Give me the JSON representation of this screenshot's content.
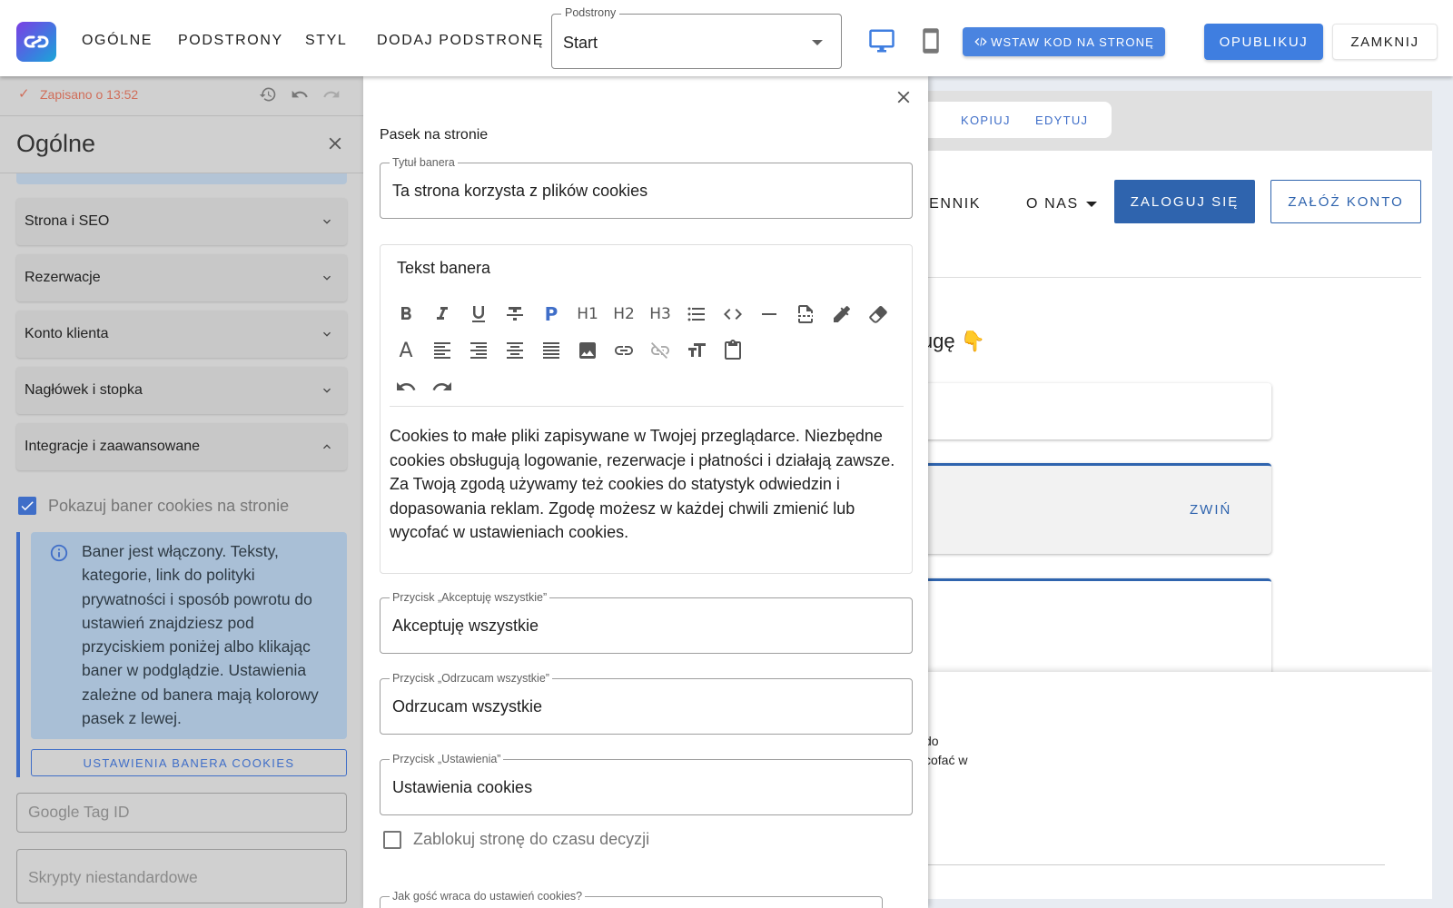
{
  "topbar": {
    "nav": [
      "OGÓLNE",
      "PODSTRONY",
      "STYL",
      "DODAJ PODSTRONĘ"
    ],
    "subpages_legend": "Podstrony",
    "subpages_value": "Start",
    "insert_code_label": "WSTAW KOD NA STRONĘ",
    "publish_label": "OPUBLIKUJ",
    "close_label": "ZAMKNIJ"
  },
  "left": {
    "saved_text": "Zapisano o 13:52",
    "title": "Ogólne",
    "accordion": [
      {
        "label": "Strona i SEO"
      },
      {
        "label": "Rezerwacje"
      },
      {
        "label": "Konto klienta"
      },
      {
        "label": "Nagłówek i stopka"
      },
      {
        "label": "Integracje i zaawansowane"
      }
    ],
    "cookie_checkbox_label": "Pokazuj baner cookies na stronie",
    "info_text": "Baner jest włączony. Teksty, kategorie, link do polityki prywatności i sposób powrotu do ustawień znajdziesz pod przyciskiem poniżej albo klikając baner w podglądzie. Ustawienia zależne od banera mają kolorowy pasek z lewej.",
    "cookie_settings_button": "USTAWIENIA BANERA COOKIES",
    "google_tag_placeholder": "Google Tag ID",
    "custom_scripts_placeholder": "Skrypty niestandardowe"
  },
  "editor": {
    "section_title": "Pasek na stronie",
    "banner_title_legend": "Tytuł banera",
    "banner_title_value": "Ta strona korzysta z plików cookies",
    "banner_text_title": "Tekst banera",
    "banner_text_body": "Cookies to małe pliki zapisywane w Twojej przeglądarce. Niezbędne cookies obsługują logowanie, rezerwacje i płatności i działają zawsze. Za Twoją zgodą używamy też cookies do statystyk odwiedzin i dopasowania reklam. Zgodę możesz w każdej chwili zmienić lub wycofać w ustawieniach cookies.",
    "accept_legend": "Przycisk „Akceptuję wszystkie”",
    "accept_value": "Akceptuję wszystkie",
    "reject_legend": "Przycisk „Odrzucam wszystkie”",
    "reject_value": "Odrzucam wszystkie",
    "settings_legend": "Przycisk „Ustawienia”",
    "settings_value": "Ustawienia cookies",
    "block_checkbox_label": "Zablokuj stronę do czasu decyzji",
    "return_legend": "Jak gość wraca do ustawień cookies?"
  },
  "preview": {
    "tab_copy": "KOPIUJ",
    "tab_edit": "EDYTUJ",
    "nav_pricing": "CENNIK",
    "nav_about": "O NAS",
    "login": "ZALOGUJ SIĘ",
    "register": "ZAŁÓŻ KONTO",
    "heading_fragment": "ługę 👇",
    "collapse": "ZWIŃ",
    "banner_line1": "do",
    "banner_line2": "cofać w"
  },
  "colors": {
    "accent": "#3f7ee0",
    "primary_dark": "#2f64ae",
    "saved": "#d06e5a",
    "info_bg": "#a9bfd6"
  }
}
